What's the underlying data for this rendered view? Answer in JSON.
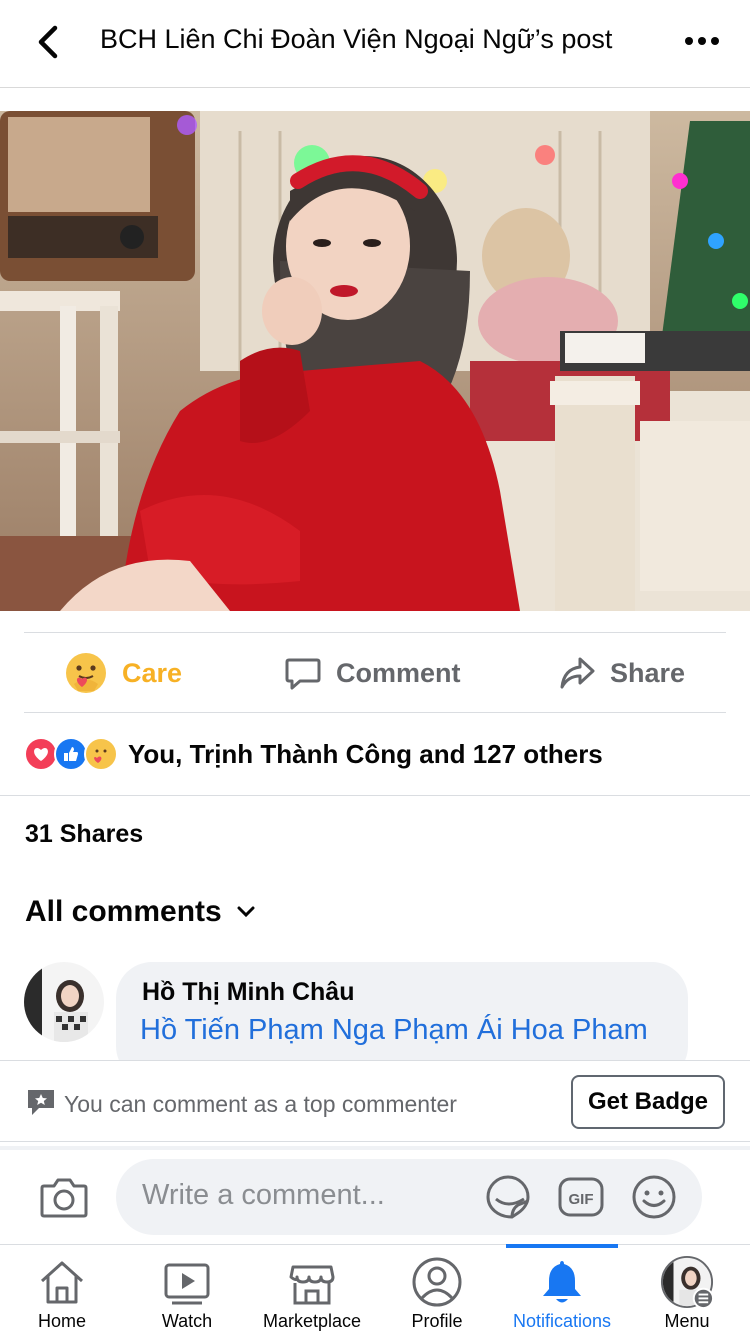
{
  "header": {
    "title": "BCH Liên Chi Đoàn Viện Ngoại Ngữ’s post",
    "back_icon": "chevron-left-icon",
    "more_icon": "more-horizontal-icon"
  },
  "post": {
    "photo_alt": "photo"
  },
  "actions": {
    "care_label": "Care",
    "comment_label": "Comment",
    "share_label": "Share",
    "care_color": "#f7b125"
  },
  "reactions": {
    "summary": "You, Trịnh Thành Công and 127 others",
    "types": [
      "love",
      "like",
      "care"
    ]
  },
  "shares": {
    "label": "31 Shares"
  },
  "comments": {
    "filter_label": "All comments",
    "items": [
      {
        "author": "Hồ Thị Minh Châu",
        "text": "Hồ Tiến Phạm Nga Phạm Ái Hoa Pham"
      }
    ]
  },
  "top_commenter": {
    "text": "You can comment as a top commenter",
    "button_label": "Get Badge"
  },
  "composer": {
    "placeholder": "Write a comment..."
  },
  "tabbar": {
    "accent": "#1877f2",
    "items": [
      {
        "label": "Home",
        "icon": "home-icon"
      },
      {
        "label": "Watch",
        "icon": "watch-icon"
      },
      {
        "label": "Marketplace",
        "icon": "marketplace-icon"
      },
      {
        "label": "Profile",
        "icon": "profile-icon"
      },
      {
        "label": "Notifications",
        "icon": "bell-icon",
        "active": true
      },
      {
        "label": "Menu",
        "icon": "menu-avatar-icon"
      }
    ]
  }
}
